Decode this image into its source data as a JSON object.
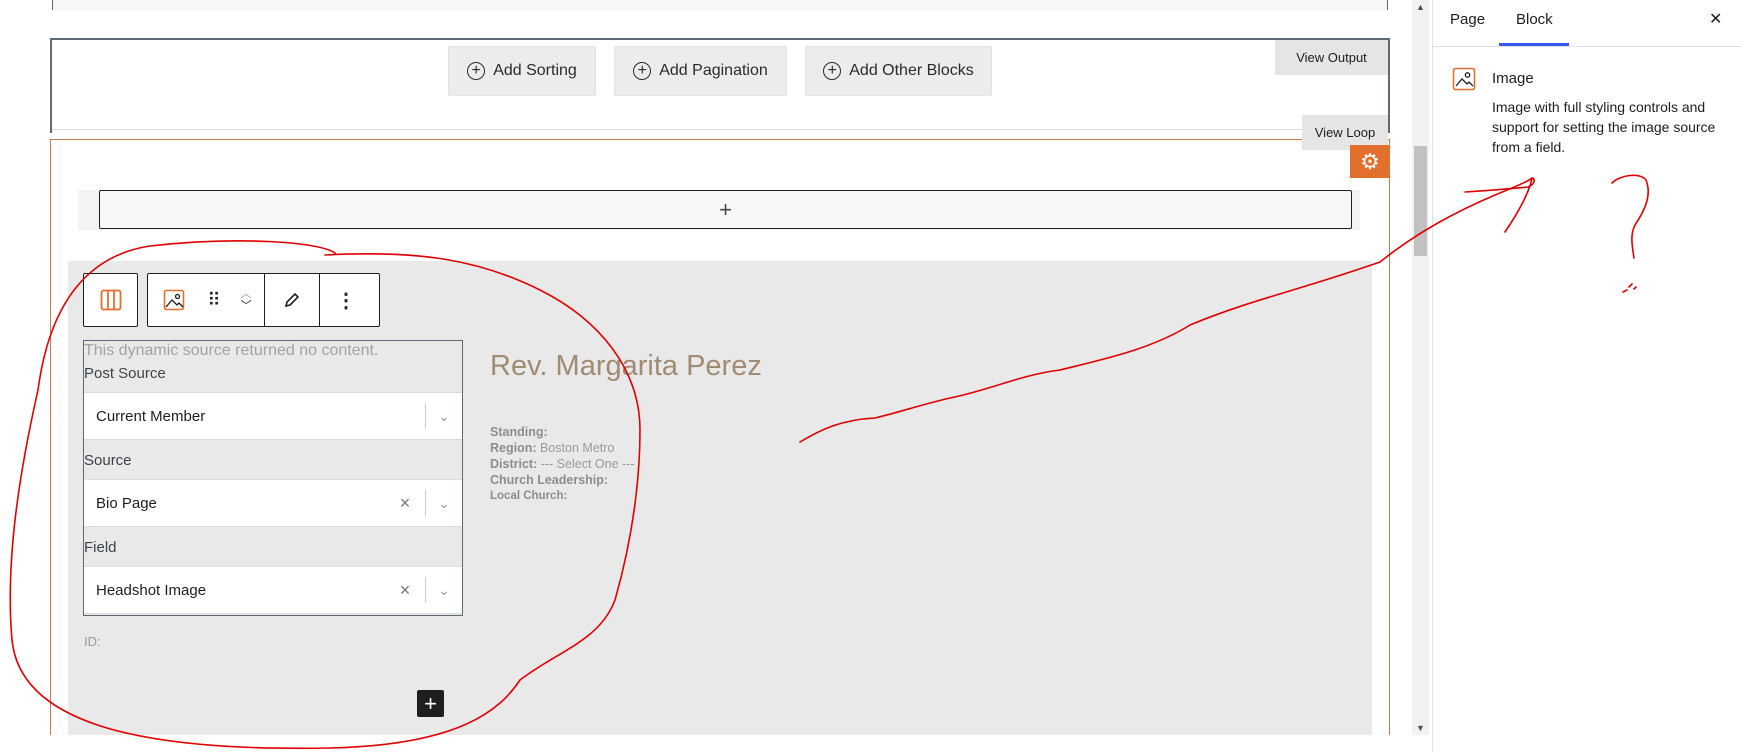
{
  "query_bar": {
    "add_sorting": "Add Sorting",
    "add_pagination": "Add Pagination",
    "add_other_blocks": "Add Other Blocks",
    "view_output": "View Output"
  },
  "loop": {
    "view_loop": "View Loop",
    "appender_symbol": "+",
    "settings_icon": "gear-icon"
  },
  "toolbar": {
    "parent_icon": "columns-icon",
    "block_icon": "image-icon",
    "drag_icon": "drag-handle-icon",
    "move_icon": "chevron-up-down-icon",
    "edit_icon": "pencil-icon",
    "more_icon": "more-vertical-icon"
  },
  "dynamic_panel": {
    "no_content": "This dynamic source returned no content.",
    "post_source_label": "Post Source",
    "post_source_value": "Current Member",
    "source_label": "Source",
    "source_value": "Bio Page",
    "field_label": "Field",
    "field_value": "Headshot Image",
    "id_label": "ID:"
  },
  "member": {
    "name": "Rev. Margarita Perez",
    "standing_label": "Standing:",
    "standing_value": "",
    "region_label": "Region:",
    "region_value": "Boston Metro",
    "district_label": "District:",
    "district_value": "--- Select One ---",
    "leadership_label": "Church Leadership:",
    "leadership_value": "",
    "local_church_label": "Local Church:",
    "local_church_value": ""
  },
  "inserter_symbol": "+",
  "sidebar": {
    "tab_page": "Page",
    "tab_block": "Block",
    "close_symbol": "✕",
    "block_name": "Image",
    "block_description": "Image with full styling controls and support for setting the image source from a field."
  },
  "colors": {
    "accent_orange": "#e36f2c",
    "tab_blue": "#3858e9",
    "annotation_red": "#e00000",
    "member_name": "#a08c74"
  }
}
